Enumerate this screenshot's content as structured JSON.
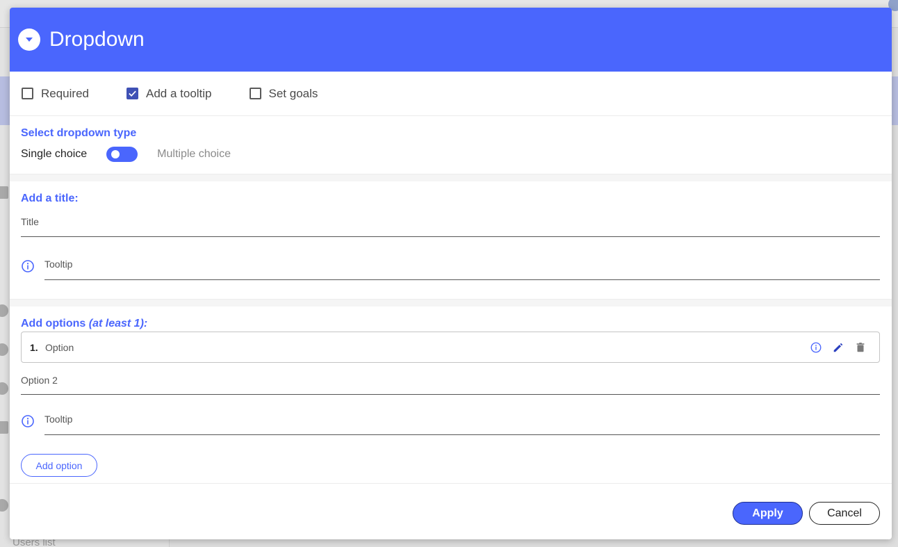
{
  "background": {
    "sidebar_bottom_text": "Users list"
  },
  "modal": {
    "title": "Dropdown",
    "title_icon": "chevron-down-circle-icon",
    "accent_color": "#4a66fd",
    "checkboxes": [
      {
        "label": "Required",
        "checked": false
      },
      {
        "label": "Add a tooltip",
        "checked": true
      },
      {
        "label": "Set goals",
        "checked": false
      }
    ],
    "dropdown_type": {
      "heading": "Select dropdown type",
      "left_label": "Single choice",
      "right_label": "Multiple choice",
      "selected": "Single choice"
    },
    "title_section": {
      "heading": "Add a title:",
      "title_placeholder": "Title",
      "tooltip_placeholder": "Tooltip"
    },
    "options_section": {
      "heading": "Add options",
      "heading_note": "(at least 1):",
      "options": [
        {
          "number": "1.",
          "label": "Option"
        }
      ],
      "new_option_placeholder": "Option 2",
      "tooltip_placeholder": "Tooltip",
      "add_button": "Add option"
    },
    "footer": {
      "apply_label": "Apply",
      "cancel_label": "Cancel"
    }
  }
}
